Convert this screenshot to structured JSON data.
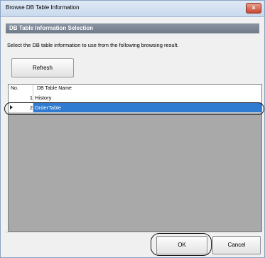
{
  "window": {
    "title": "Browse DB Table Information",
    "close_glyph": "×"
  },
  "section": {
    "header": "DB Table Information Selection"
  },
  "instruction": "Select the DB table information to use from the following browsing result.",
  "refresh_button": "Refresh",
  "table": {
    "columns": [
      "No.",
      "DB Table Name"
    ],
    "rows": [
      {
        "no": "1",
        "name": "History",
        "selected": false
      },
      {
        "no": "2",
        "name": "OrderTable",
        "selected": true
      }
    ],
    "selected_color": "#2e7bd1"
  },
  "footer": {
    "ok": "OK",
    "cancel": "Cancel"
  }
}
